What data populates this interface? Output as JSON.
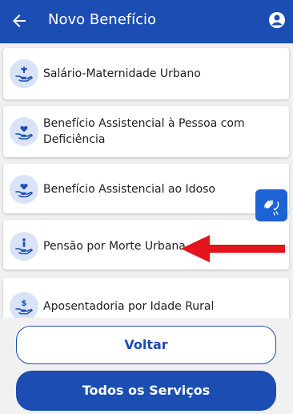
{
  "appbar": {
    "title": "Novo Benefício",
    "back_icon": "arrow-left-icon",
    "profile_icon": "user-circle-icon"
  },
  "benefits": [
    {
      "label": "Salário-Maternidade Urbano",
      "icon": "hand-plant-icon"
    },
    {
      "label": "Benefício Assistencial à Pessoa com Deficiência",
      "icon": "hand-heart-icon"
    },
    {
      "label": "Benefício Assistencial ao Idoso",
      "icon": "hand-heart-icon"
    },
    {
      "label": "Pensão por Morte Urbana",
      "icon": "hand-person-icon"
    },
    {
      "label": "Aposentadoria por Idade Rural",
      "icon": "hand-coin-icon"
    }
  ],
  "accessibility": {
    "icon": "sign-language-hands-icon"
  },
  "annotation": {
    "icon": "red-arrow-left-icon",
    "color": "#e3141c"
  },
  "footer": {
    "back_label": "Voltar",
    "all_services_label": "Todos os Serviços"
  },
  "colors": {
    "primary": "#1b4db3",
    "icon_bg": "#d9e3f6",
    "background": "#f1f1f1"
  }
}
